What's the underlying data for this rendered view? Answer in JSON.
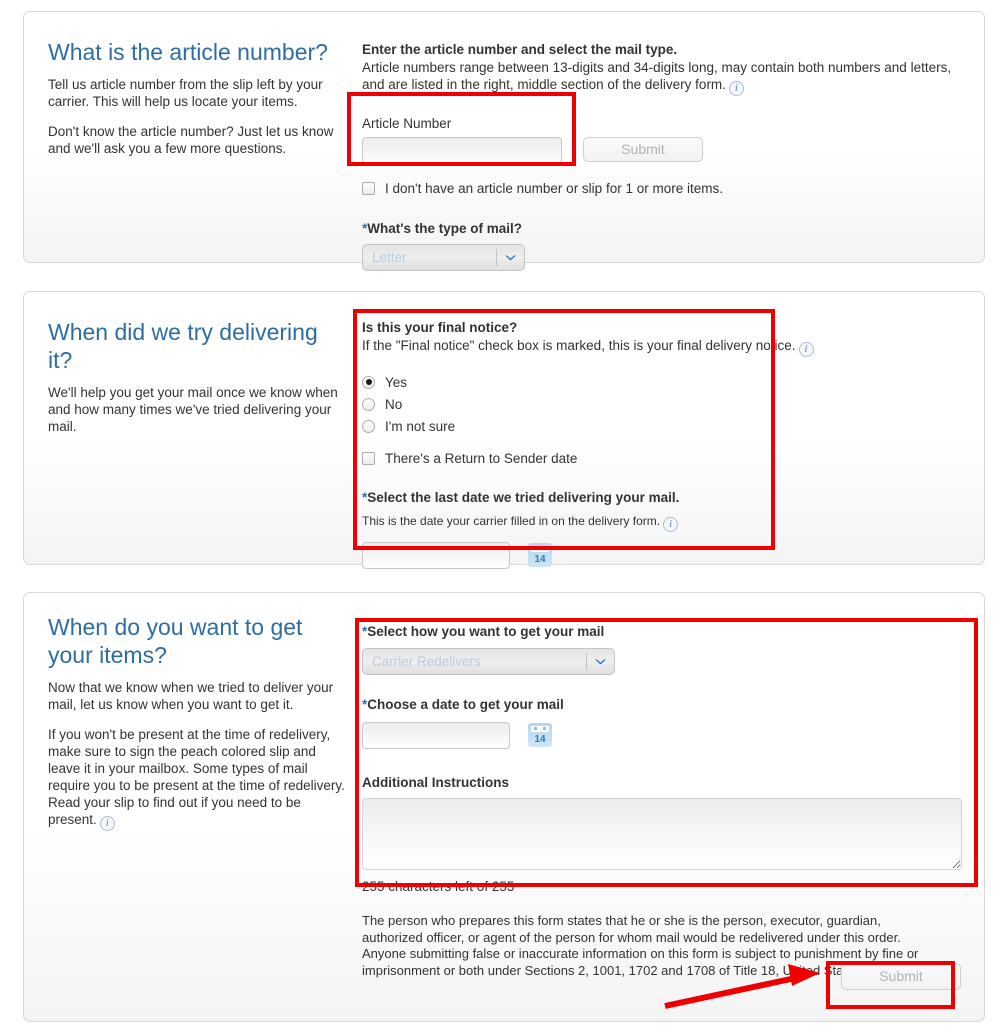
{
  "sections": [
    {
      "id": "article",
      "title": "What is the article number?",
      "paragraphs": [
        "Tell us article number from the slip left by your carrier. This will help us locate your items.",
        "Don't know the article number? Just let us know and we'll ask you a few more questions."
      ],
      "lead": "Enter the article number and select the mail type.",
      "lead_sub": "Article numbers range between 13-digits and 34-digits long, may contain both numbers and letters, and are listed in the right, middle section of the delivery form.",
      "info_icon": "info-icon",
      "article_label": "Article Number",
      "article_value": "",
      "article_placeholder": "",
      "submit_label": "Submit",
      "no_article_checkbox": "I don't have an article number or slip for 1 or more items.",
      "no_article_checked": false,
      "mail_type_label": "What's the type of mail?",
      "mail_type_required": "*",
      "mail_type_value": "Letter"
    },
    {
      "id": "delivery",
      "title": "When did we try delivering it?",
      "paragraphs": [
        "We'll help you get your mail once we know when and how many times we've tried delivering your mail."
      ],
      "lead": "Is this your final notice?",
      "lead_sub": "If the \"Final notice\" check box is marked, this is your final delivery notice.",
      "info_icon": "info-icon",
      "radio_options": [
        {
          "label": "Yes",
          "selected": true
        },
        {
          "label": "No",
          "selected": false
        },
        {
          "label": "I'm not sure",
          "selected": false
        }
      ],
      "return_checkbox": "There's a Return to Sender date",
      "return_checked": false,
      "date_label": "Select the last date we tried delivering your mail.",
      "date_required": "*",
      "date_note": "This is the date your carrier filled in on the delivery form.",
      "date_value": "",
      "calendar_icon": "calendar-icon",
      "calendar_day": "14"
    },
    {
      "id": "receive",
      "title": "When do you want to get your items?",
      "paragraphs": [
        "Now that we know when we tried to deliver your mail, let us know when you want to get it.",
        "If you won't be present at the time of redelivery, make sure to sign the peach colored slip and leave it in your mailbox. Some types of mail require you to be present at the time of redelivery. Read your slip to find out if you need to be present."
      ],
      "info_icon": "info-icon",
      "method_label": "Select how you want to get your mail",
      "method_required": "*",
      "method_value": "Carrier Redelivers",
      "date_label": "Choose a date to get your mail",
      "date_required": "*",
      "date_value": "",
      "calendar_icon": "calendar-icon",
      "calendar_day": "14",
      "instructions_label": "Additional Instructions",
      "instructions_value": "",
      "char_counter": "255 characters left of 255",
      "legal": "The person who prepares this form states that he or she is the person, executor, guardian, authorized officer, or agent of the person for whom mail would be redelivered under this order. Anyone submitting false or inaccurate information on this form is subject to punishment by fine or imprisonment or both under Sections 2, 1001, 1702 and 1708 of Title 18, United States Code.",
      "submit_label": "Submit"
    }
  ],
  "annotations": {
    "highlight_color": "#ee0000",
    "arrow_color": "#ee0000"
  },
  "colors": {
    "heading_blue": "#2e6da4",
    "body_text": "#333333",
    "panel_border": "#d8d8d8"
  }
}
